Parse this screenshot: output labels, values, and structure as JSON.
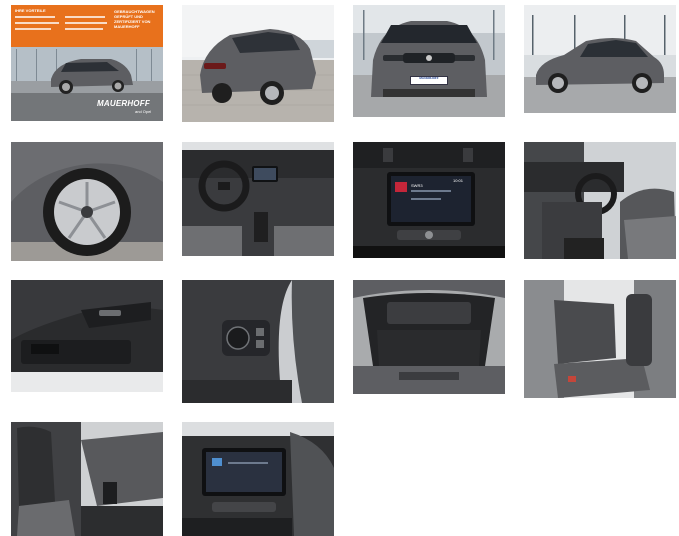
{
  "gallery": {
    "thumbnails": [
      {
        "id": "exterior-front-left-dealership",
        "alt": "Grey hatchback in front of dealership"
      },
      {
        "id": "exterior-rear-left",
        "alt": "Rear three-quarter view"
      },
      {
        "id": "exterior-front",
        "alt": "Front view"
      },
      {
        "id": "exterior-side",
        "alt": "Side profile"
      },
      {
        "id": "wheel",
        "alt": "Alloy wheel"
      },
      {
        "id": "dashboard",
        "alt": "Dashboard and steering wheel"
      },
      {
        "id": "infotainment",
        "alt": "Infotainment screen"
      },
      {
        "id": "driver-area",
        "alt": "Driver seat and dashboard"
      },
      {
        "id": "door-panel",
        "alt": "Door panel"
      },
      {
        "id": "light-switch",
        "alt": "Light switch"
      },
      {
        "id": "trunk",
        "alt": "Trunk"
      },
      {
        "id": "rear-seats",
        "alt": "Rear seats"
      },
      {
        "id": "front-seats",
        "alt": "Front seats"
      },
      {
        "id": "center-console",
        "alt": "Center console"
      }
    ]
  },
  "banner": {
    "title": "IHRE VORTEILE",
    "right_text": "GEBRAUCHTWAGEN GEPRÜFT UND ZERTIFIZIERT VON MAUERHOFF",
    "brand": "MAUERHOFF",
    "brand_sub": "and Opel"
  },
  "front_plate": {
    "text": "MAUERHOFF"
  },
  "infotainment_screen": {
    "source": "SWR3",
    "time": "10:01"
  },
  "colors": {
    "banner_orange": "#e8711c",
    "car_grey": "#5d5e62",
    "interior_dark": "#2b2c2e",
    "plate_blue": "#1a3d8f"
  }
}
